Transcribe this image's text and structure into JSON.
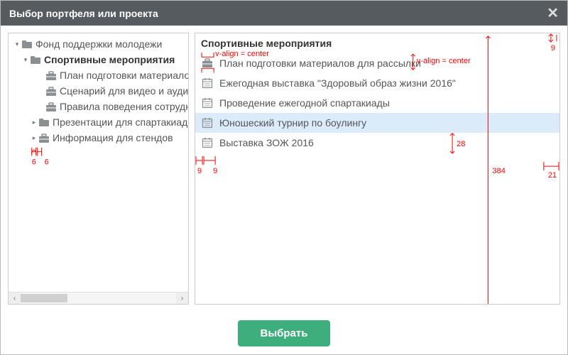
{
  "title": "Выбор портфеля или проекта",
  "tree": [
    {
      "indent": 6,
      "expander": "down",
      "icon": "folder",
      "label": "Фонд поддержки молодежи",
      "bold": false
    },
    {
      "indent": 18,
      "expander": "down",
      "icon": "folder",
      "label": "Спортивные мероприятия",
      "bold": true
    },
    {
      "indent": 40,
      "expander": "",
      "icon": "brief",
      "label": "План подготовки материалов д",
      "bold": false
    },
    {
      "indent": 40,
      "expander": "",
      "icon": "brief",
      "label": "Сценарий для видео и аудиороли",
      "bold": false
    },
    {
      "indent": 40,
      "expander": "",
      "icon": "brief",
      "label": "Правила поведения сотрудников",
      "bold": false
    },
    {
      "indent": 30,
      "expander": "right",
      "icon": "folder",
      "label": "Презентации для спартакиады",
      "bold": false
    },
    {
      "indent": 30,
      "expander": "right",
      "icon": "brief",
      "label": "Информация для стендов",
      "bold": false
    }
  ],
  "list_header": "Спортивные мероприятия",
  "list": [
    {
      "icon": "brief",
      "label": "План подготовки материалов для рассылки",
      "selected": false
    },
    {
      "icon": "cal",
      "label": "Ежегодная выставка \"Здоровый образ жизни 2016\"",
      "selected": false
    },
    {
      "icon": "cal",
      "label": "Проведение ежегодной спартакиады",
      "selected": false
    },
    {
      "icon": "cal",
      "label": "Юношеский турнир по боулингу",
      "selected": true
    },
    {
      "icon": "cal",
      "label": "Выставка ЗОЖ 2016",
      "selected": false
    }
  ],
  "button_primary": "Выбрать",
  "annotations": {
    "valign_center_left": "v-align = center",
    "valign_center_right": "v-align = center",
    "h384": "384",
    "h28": "28",
    "m9_left": "9",
    "m9_inner": "9",
    "m21": "21",
    "m9_top": "9",
    "m6_a": "6",
    "m6_b": "6",
    "arrow_bracket_top": "⌄"
  }
}
